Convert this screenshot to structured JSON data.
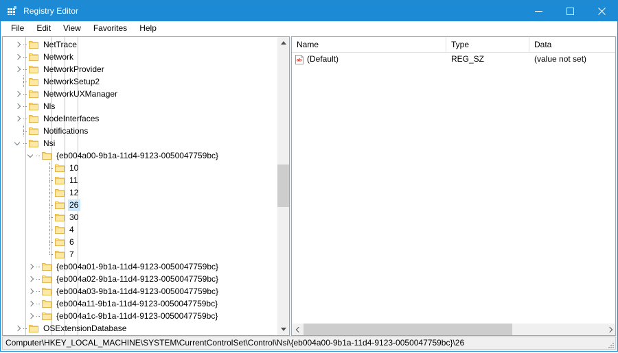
{
  "window": {
    "title": "Registry Editor",
    "icon": "registry-icon",
    "controls": {
      "minimize": "minimize-icon",
      "maximize": "maximize-icon",
      "close": "close-icon"
    }
  },
  "menubar": {
    "items": [
      {
        "label": "File"
      },
      {
        "label": "Edit"
      },
      {
        "label": "View"
      },
      {
        "label": "Favorites"
      },
      {
        "label": "Help"
      }
    ]
  },
  "tree": {
    "nodes": [
      {
        "label": "NetTrace",
        "depth": 4,
        "state": "collapsed",
        "selected": false,
        "last": false
      },
      {
        "label": "Network",
        "depth": 4,
        "state": "collapsed",
        "selected": false,
        "last": false
      },
      {
        "label": "NetworkProvider",
        "depth": 4,
        "state": "collapsed",
        "selected": false,
        "last": false
      },
      {
        "label": "NetworkSetup2",
        "depth": 4,
        "state": "leaf",
        "selected": false,
        "last": false
      },
      {
        "label": "NetworkUXManager",
        "depth": 4,
        "state": "collapsed",
        "selected": false,
        "last": false
      },
      {
        "label": "Nls",
        "depth": 4,
        "state": "collapsed",
        "selected": false,
        "last": false
      },
      {
        "label": "NodeInterfaces",
        "depth": 4,
        "state": "collapsed",
        "selected": false,
        "last": false
      },
      {
        "label": "Notifications",
        "depth": 4,
        "state": "leaf",
        "selected": false,
        "last": false
      },
      {
        "label": "Nsi",
        "depth": 4,
        "state": "expanded",
        "selected": false,
        "last": false
      },
      {
        "label": "{eb004a00-9b1a-11d4-9123-0050047759bc}",
        "depth": 5,
        "state": "expanded",
        "selected": false,
        "last": false
      },
      {
        "label": "10",
        "depth": 6,
        "state": "leaf",
        "selected": false,
        "last": false
      },
      {
        "label": "11",
        "depth": 6,
        "state": "leaf",
        "selected": false,
        "last": false
      },
      {
        "label": "12",
        "depth": 6,
        "state": "leaf",
        "selected": false,
        "last": false
      },
      {
        "label": "26",
        "depth": 6,
        "state": "leaf",
        "selected": true,
        "last": false
      },
      {
        "label": "30",
        "depth": 6,
        "state": "leaf",
        "selected": false,
        "last": false
      },
      {
        "label": "4",
        "depth": 6,
        "state": "leaf",
        "selected": false,
        "last": false
      },
      {
        "label": "6",
        "depth": 6,
        "state": "leaf",
        "selected": false,
        "last": false
      },
      {
        "label": "7",
        "depth": 6,
        "state": "leaf",
        "selected": false,
        "last": true
      },
      {
        "label": "{eb004a01-9b1a-11d4-9123-0050047759bc}",
        "depth": 5,
        "state": "collapsed",
        "selected": false,
        "last": false
      },
      {
        "label": "{eb004a02-9b1a-11d4-9123-0050047759bc}",
        "depth": 5,
        "state": "collapsed",
        "selected": false,
        "last": false
      },
      {
        "label": "{eb004a03-9b1a-11d4-9123-0050047759bc}",
        "depth": 5,
        "state": "collapsed",
        "selected": false,
        "last": false
      },
      {
        "label": "{eb004a11-9b1a-11d4-9123-0050047759bc}",
        "depth": 5,
        "state": "collapsed",
        "selected": false,
        "last": false
      },
      {
        "label": "{eb004a1c-9b1a-11d4-9123-0050047759bc}",
        "depth": 5,
        "state": "collapsed",
        "selected": false,
        "last": true
      },
      {
        "label": "OSExtensionDatabase",
        "depth": 4,
        "state": "collapsed",
        "selected": false,
        "last": false
      }
    ],
    "scrollbar": {
      "up": "scroll-up-icon",
      "down": "scroll-down-icon"
    }
  },
  "list": {
    "columns": [
      {
        "label": "Name"
      },
      {
        "label": "Type"
      },
      {
        "label": "Data"
      }
    ],
    "rows": [
      {
        "icon": "string-value-icon",
        "name": "(Default)",
        "type": "REG_SZ",
        "data": "(value not set)"
      }
    ],
    "scrollbar": {
      "left": "scroll-left-icon",
      "right": "scroll-right-icon"
    }
  },
  "statusbar": {
    "path": "Computer\\HKEY_LOCAL_MACHINE\\SYSTEM\\CurrentControlSet\\Control\\Nsi\\{eb004a00-9b1a-11d4-9123-0050047759bc}\\26",
    "grip": "resize-grip-icon"
  },
  "colors": {
    "titlebar": "#1c8ad4",
    "selection": "#cce8ff",
    "folder": "#fde8a6",
    "folder_border": "#e0b64a",
    "pane_border": "#9ba7b0"
  }
}
